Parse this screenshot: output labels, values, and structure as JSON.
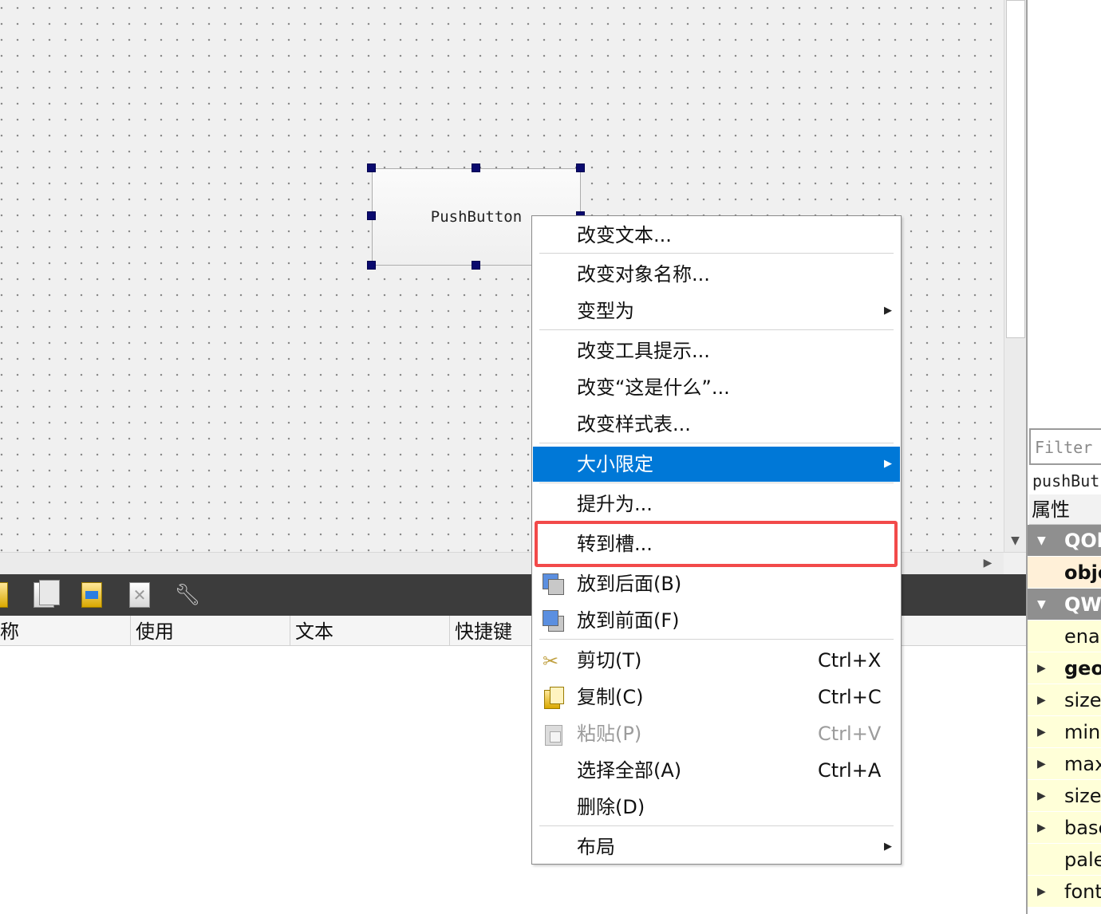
{
  "designer": {
    "widget_text": "PushButton"
  },
  "context_menu": {
    "items": [
      {
        "label": "改变文本..."
      },
      {
        "label": "改变对象名称..."
      },
      {
        "label": "变型为"
      },
      {
        "label": "改变工具提示..."
      },
      {
        "label": "改变“这是什么”..."
      },
      {
        "label": "改变样式表..."
      },
      {
        "label": "大小限定"
      },
      {
        "label": "提升为..."
      },
      {
        "label": "转到槽..."
      },
      {
        "label": "放到后面(B)"
      },
      {
        "label": "放到前面(F)"
      },
      {
        "label": "剪切(T)",
        "shortcut": "Ctrl+X"
      },
      {
        "label": "复制(C)",
        "shortcut": "Ctrl+C"
      },
      {
        "label": "粘贴(P)",
        "shortcut": "Ctrl+V"
      },
      {
        "label": "选择全部(A)",
        "shortcut": "Ctrl+A"
      },
      {
        "label": "删除(D)"
      },
      {
        "label": "布局"
      }
    ],
    "highlight_color": "#0078d7",
    "callout_color": "#f24a4a"
  },
  "action_editor": {
    "columns": [
      "称",
      "使用",
      "文本",
      "快捷键"
    ]
  },
  "property_editor": {
    "filter_placeholder": "Filter",
    "object_name": "pushBut",
    "header": "属性",
    "rows": [
      {
        "label": "QOb"
      },
      {
        "label": "obje"
      },
      {
        "label": "QW"
      },
      {
        "label": "enal"
      },
      {
        "label": "geo"
      },
      {
        "label": "sizeI"
      },
      {
        "label": "mini"
      },
      {
        "label": "max"
      },
      {
        "label": "sizeI"
      },
      {
        "label": "base"
      },
      {
        "label": "pale"
      },
      {
        "label": "font"
      }
    ]
  }
}
